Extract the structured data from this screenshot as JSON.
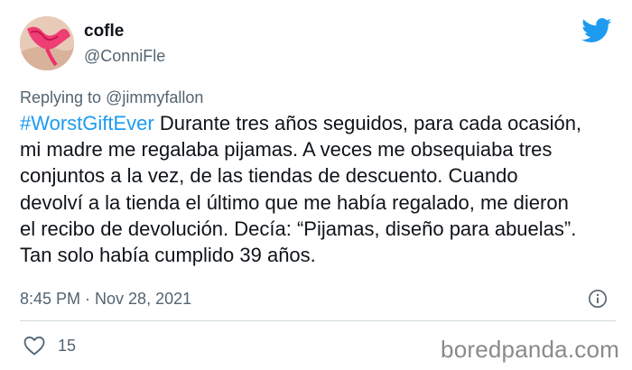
{
  "author": {
    "display_name": "cofle",
    "handle": "@ConniFle"
  },
  "reply": {
    "prefix": "Replying to ",
    "mention": "@jimmyfallon"
  },
  "tweet": {
    "hashtag": "#WorstGiftEver",
    "lines": [
      " Durante tres años seguidos, para cada ocasión,",
      "mi madre me regalaba pijamas. A veces me obsequiaba tres",
      "conjuntos a la vez, de las tiendas de descuento. Cuando",
      "devolví a la tienda el último que me había regalado, me dieron",
      "el recibo de devolución. Decía: “Pijamas, diseño para abuelas”.",
      "Tan solo había cumplido 39 años."
    ]
  },
  "timestamp": "8:45 PM · Nov 28, 2021",
  "likes": {
    "count": "15"
  },
  "watermark": "boredpanda.com",
  "icons": {
    "brand": "twitter-bird-icon",
    "info": "info-icon",
    "like": "heart-icon"
  },
  "colors": {
    "twitter_blue": "#1d9bf0",
    "secondary_text": "#536471",
    "primary_text": "#0f1419",
    "divider": "#cfd9de"
  }
}
